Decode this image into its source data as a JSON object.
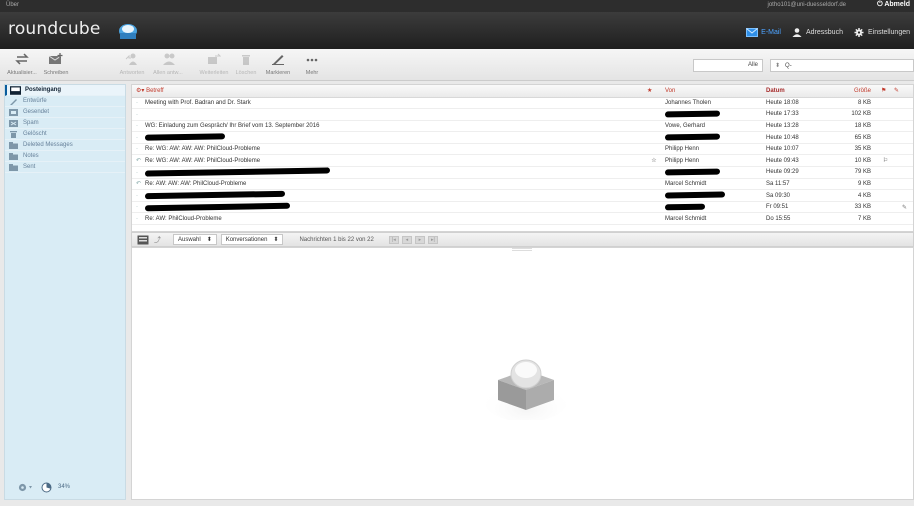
{
  "topbar": {
    "about": "Über",
    "user": "jotho101@uni-duesseldorf.de",
    "logout": "Abmeld"
  },
  "app": {
    "logo": "roundcube"
  },
  "nav": [
    {
      "label": "E-Mail",
      "icon": "mail-icon",
      "active": true
    },
    {
      "label": "Adressbuch",
      "icon": "user-icon",
      "active": false
    },
    {
      "label": "Einstellungen",
      "icon": "gear-icon",
      "active": false
    }
  ],
  "toolbar": {
    "buttons": [
      {
        "label": "Aktualisier...",
        "icon": "refresh-icon",
        "disabled": false
      },
      {
        "label": "Schreiben",
        "icon": "compose-icon",
        "disabled": false
      },
      {
        "label": "Antworten",
        "icon": "reply-icon",
        "disabled": true
      },
      {
        "label": "Allen antw...",
        "icon": "reply-all-icon",
        "disabled": true
      },
      {
        "label": "Weiterleiten",
        "icon": "forward-icon",
        "disabled": true
      },
      {
        "label": "Löschen",
        "icon": "trash-icon",
        "disabled": true
      },
      {
        "label": "Markieren",
        "icon": "mark-icon",
        "disabled": false
      },
      {
        "label": "Mehr",
        "icon": "more-icon",
        "disabled": false
      }
    ],
    "filter": "Alle",
    "search_placeholder": "Q-"
  },
  "folders": [
    {
      "label": "Posteingang",
      "icon": "inbox-icon",
      "active": true
    },
    {
      "label": "Entwürfe",
      "icon": "drafts-icon",
      "active": false
    },
    {
      "label": "Gesendet",
      "icon": "sent-icon",
      "active": false
    },
    {
      "label": "Spam",
      "icon": "spam-icon",
      "active": false
    },
    {
      "label": "Gelöscht",
      "icon": "trash-icon",
      "active": false
    },
    {
      "label": "Deleted Messages",
      "icon": "folder-icon",
      "active": false
    },
    {
      "label": "Notes",
      "icon": "folder-icon",
      "active": false
    },
    {
      "label": "Sent",
      "icon": "folder-icon",
      "active": false
    }
  ],
  "quota": "34%",
  "list": {
    "headers": {
      "subject": "Betreff",
      "from": "Von",
      "date": "Datum",
      "size": "Größe"
    },
    "rows": [
      {
        "subject": "Meeting with Prof. Badran and Dr. Stark",
        "from": "Johannes Tholen",
        "date": "Heute 18:08",
        "size": "8 KB",
        "replied": false,
        "redact_subject": false,
        "redact_from": false,
        "attach": false,
        "flag": false
      },
      {
        "subject": "",
        "from": "",
        "date": "Heute 17:33",
        "size": "102 KB",
        "replied": false,
        "redact_subject": true,
        "redact_from": true,
        "attach": false,
        "flag": false
      },
      {
        "subject": "WG: Einladung zum Gespräch/ Ihr Brief vom 13. September 2016",
        "from": "Vowe, Gerhard",
        "date": "Heute 13:28",
        "size": "18 KB",
        "replied": false,
        "redact_subject": false,
        "redact_from": false,
        "attach": false,
        "flag": false
      },
      {
        "subject": "",
        "from": "",
        "date": "Heute 10:48",
        "size": "65 KB",
        "replied": false,
        "redact_subject": true,
        "redact_from": true,
        "attach": false,
        "flag": false
      },
      {
        "subject": "Re: WG: AW: AW: AW: PhilCloud-Probleme",
        "from": "Philipp Henn",
        "date": "Heute 10:07",
        "size": "35 KB",
        "replied": false,
        "redact_subject": false,
        "redact_from": false,
        "attach": false,
        "flag": false
      },
      {
        "subject": "Re: WG: AW: AW: AW: PhilCloud-Probleme",
        "from": "Philipp Henn",
        "date": "Heute 09:43",
        "size": "10 KB",
        "replied": true,
        "redact_subject": false,
        "redact_from": false,
        "attach": false,
        "flag": true
      },
      {
        "subject": "",
        "from": "",
        "date": "Heute 09:29",
        "size": "79 KB",
        "replied": false,
        "redact_subject": true,
        "redact_from": true,
        "attach": false,
        "flag": false
      },
      {
        "subject": "Re: AW: AW: AW: PhilCloud-Probleme",
        "from": "Marcel Schmidt",
        "date": "Sa 11:57",
        "size": "9 KB",
        "replied": true,
        "redact_subject": false,
        "redact_from": false,
        "attach": false,
        "flag": false
      },
      {
        "subject": "",
        "from": "",
        "date": "Sa 09:30",
        "size": "4 KB",
        "replied": false,
        "redact_subject": true,
        "redact_from": true,
        "attach": false,
        "flag": false
      },
      {
        "subject": "",
        "from": "",
        "date": "Fr 09:51",
        "size": "33 KB",
        "replied": false,
        "redact_subject": true,
        "redact_from": true,
        "attach": true,
        "flag": false
      },
      {
        "subject": "Re: AW: PhilCloud-Probleme",
        "from": "Marcel Schmidt",
        "date": "Do 15:55",
        "size": "7 KB",
        "replied": false,
        "redact_subject": false,
        "redact_from": false,
        "attach": false,
        "flag": false
      }
    ]
  },
  "listfooter": {
    "select": "Auswahl",
    "threads": "Konversationen",
    "count": "Nachrichten 1 bis 22 von 22"
  }
}
